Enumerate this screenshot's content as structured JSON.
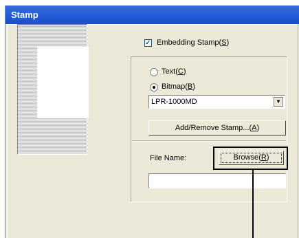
{
  "window": {
    "title": "Stamp"
  },
  "stamp": {
    "embedding": {
      "label": "Embedding Stamp",
      "key": "S",
      "checked": true
    },
    "text_option": {
      "label": "Text",
      "key": "C",
      "selected": false
    },
    "bitmap_option": {
      "label": "Bitmap",
      "key": "B",
      "selected": true
    },
    "bitmap_select": {
      "value": "LPR-1000MD"
    },
    "add_remove": {
      "label": "Add/Remove Stamp...",
      "key": "A"
    },
    "file_name_label": "File Name:",
    "browse": {
      "label": "Browse",
      "key": "R"
    },
    "file_name_value": ""
  }
}
